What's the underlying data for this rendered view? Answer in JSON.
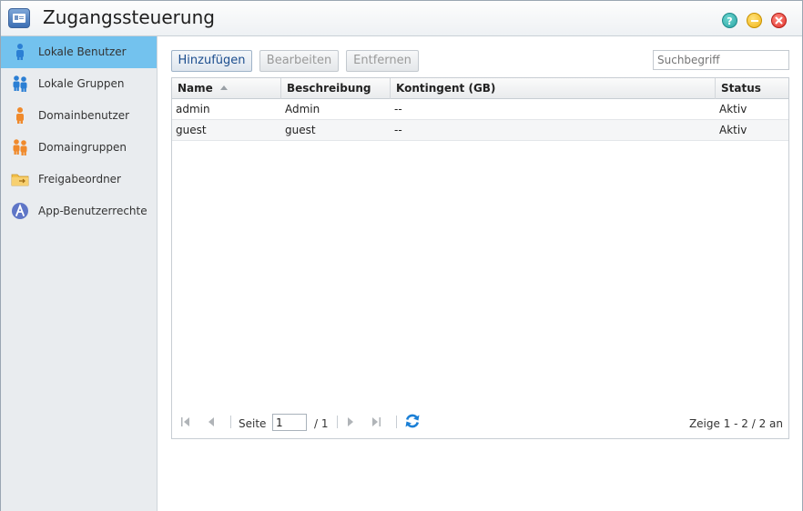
{
  "window": {
    "title": "Zugangssteuerung",
    "help_label": "?",
    "accent": "#73c2ee"
  },
  "sidebar": {
    "items": [
      {
        "label": "Lokale Benutzer",
        "icon": "user-icon",
        "active": true
      },
      {
        "label": "Lokale Gruppen",
        "icon": "group-icon",
        "active": false
      },
      {
        "label": "Domainbenutzer",
        "icon": "domain-user-icon",
        "active": false
      },
      {
        "label": "Domaingruppen",
        "icon": "domain-group-icon",
        "active": false
      },
      {
        "label": "Freigabeordner",
        "icon": "shared-folder-icon",
        "active": false
      },
      {
        "label": "App-Benutzerrechte",
        "icon": "app-privileges-icon",
        "active": false
      }
    ]
  },
  "toolbar": {
    "add_label": "Hinzufügen",
    "edit_label": "Bearbeiten",
    "remove_label": "Entfernen",
    "search_placeholder": "Suchbegriff"
  },
  "table": {
    "columns": [
      "Name",
      "Beschreibung",
      "Kontingent (GB)",
      "Status"
    ],
    "rows": [
      [
        "admin",
        "Admin",
        "--",
        "Aktiv"
      ],
      [
        "guest",
        "guest",
        "--",
        "Aktiv"
      ]
    ]
  },
  "pager": {
    "page_label": "Seite",
    "page_value": "1",
    "page_total": "/ 1",
    "display_info": "Zeige 1 - 2 / 2 an"
  }
}
